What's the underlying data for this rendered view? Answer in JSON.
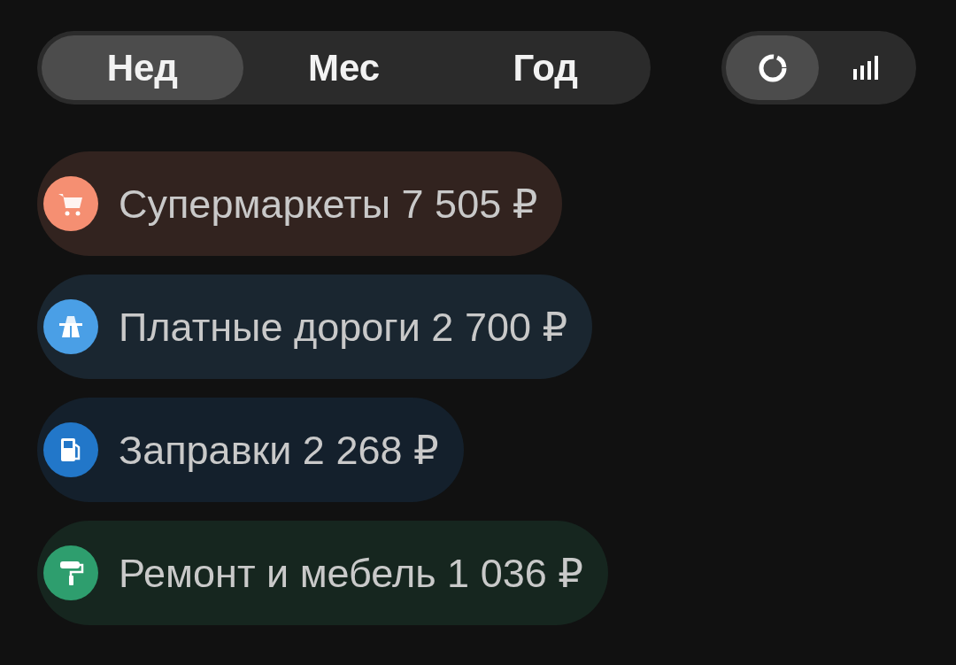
{
  "period_tabs": [
    {
      "label": "Нед",
      "selected": true
    },
    {
      "label": "Мес",
      "selected": false
    },
    {
      "label": "Год",
      "selected": false
    }
  ],
  "view_toggle": [
    {
      "kind": "donut",
      "selected": true
    },
    {
      "kind": "bars",
      "selected": false
    }
  ],
  "categories": [
    {
      "kind": "cart",
      "label": "Супермаркеты 7 505 ₽",
      "color": "#f58f72"
    },
    {
      "kind": "road",
      "label": "Платные дороги 2 700 ₽",
      "color": "#4a9fe6"
    },
    {
      "kind": "fuel",
      "label": "Заправки 2 268 ₽",
      "color": "#2277c9"
    },
    {
      "kind": "roller",
      "label": "Ремонт и мебель 1 036 ₽",
      "color": "#2e9e6e"
    }
  ]
}
